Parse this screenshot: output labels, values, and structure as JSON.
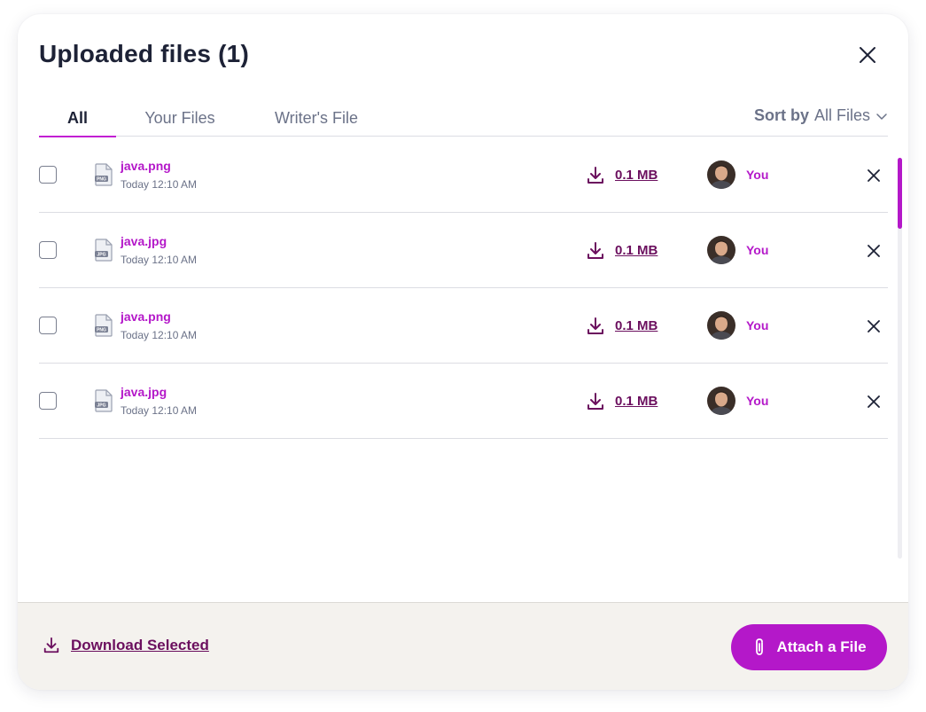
{
  "modal": {
    "title": "Uploaded files (1)"
  },
  "tabs": [
    {
      "label": "All",
      "active": true
    },
    {
      "label": "Your Files",
      "active": false
    },
    {
      "label": "Writer's File",
      "active": false
    }
  ],
  "sort": {
    "label": "Sort by",
    "value": "All Files"
  },
  "files": [
    {
      "name": "java.png",
      "type_badge": "PNG",
      "date": "Today 12:10 AM",
      "size": "0.1 MB",
      "owner": "You"
    },
    {
      "name": "java.jpg",
      "type_badge": "JPG",
      "date": "Today 12:10 AM",
      "size": "0.1 MB",
      "owner": "You"
    },
    {
      "name": "java.png",
      "type_badge": "PNG",
      "date": "Today 12:10 AM",
      "size": "0.1 MB",
      "owner": "You"
    },
    {
      "name": "java.jpg",
      "type_badge": "JPG",
      "date": "Today 12:10 AM",
      "size": "0.1 MB",
      "owner": "You"
    }
  ],
  "footer": {
    "download_selected": "Download Selected",
    "attach_button": "Attach a File"
  },
  "icons": {
    "close": "close-icon",
    "download": "download-icon",
    "paperclip": "paperclip-icon",
    "chevron": "chevron-down-icon",
    "file": "file-image-icon"
  },
  "colors": {
    "accent": "#b418c9",
    "dark_accent": "#6b0f5e",
    "text": "#1d2236",
    "muted": "#6b7288",
    "footer_bg": "#f4f2ee"
  }
}
